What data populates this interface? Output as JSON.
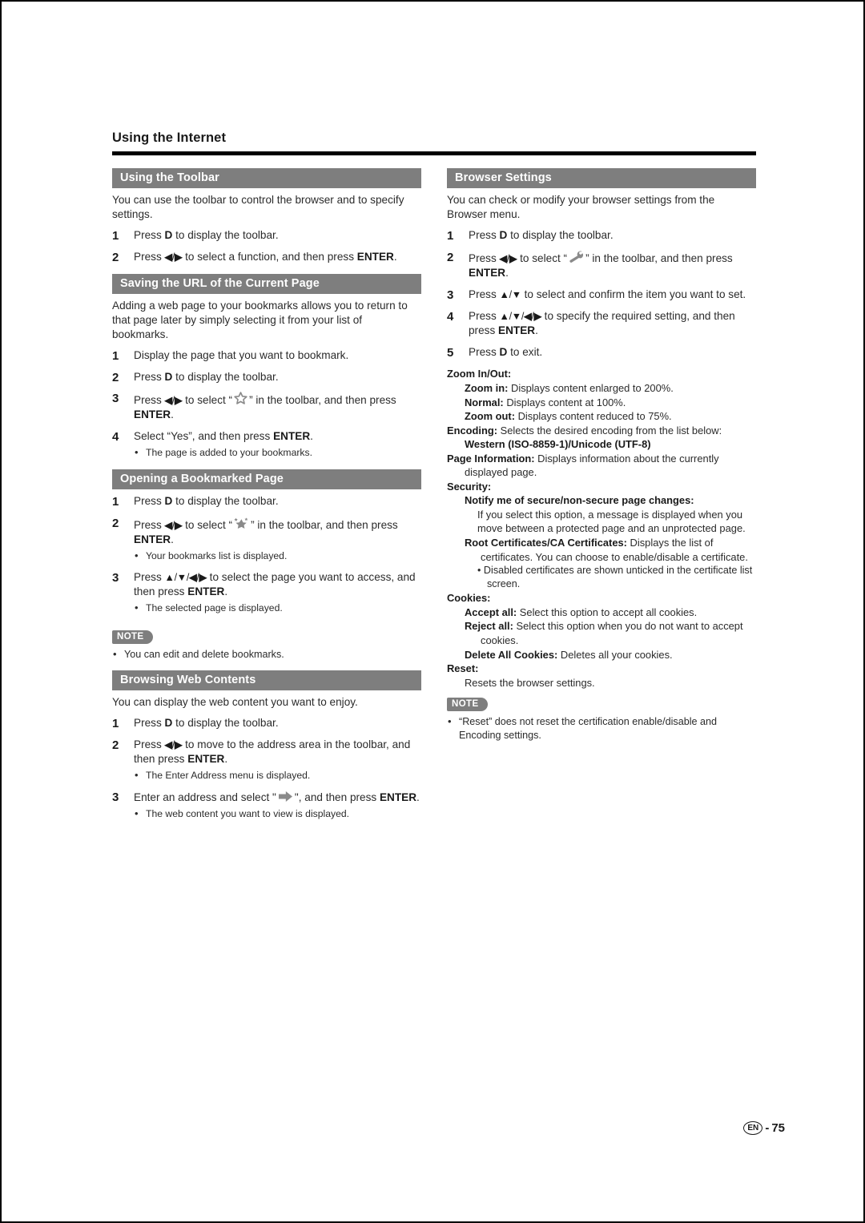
{
  "page": {
    "running_head": "Using the Internet",
    "footer_lang": "EN",
    "footer_sep": "-",
    "footer_page": "75"
  },
  "left_column": {
    "sections": [
      {
        "id": "using-the-toolbar",
        "heading": "Using the Toolbar",
        "intro": "You can use the toolbar to control the browser and to specify settings.",
        "steps": [
          {
            "num": "1",
            "text": "Press D to display the toolbar."
          },
          {
            "num": "2",
            "text": "Press ◀/▶ to select a function, and then press ENTER."
          }
        ]
      },
      {
        "id": "saving-the-url",
        "heading": "Saving the URL of the Current Page",
        "intro": "Adding a web page to your bookmarks allows you to return to that page later by simply selecting it from your list of bookmarks.",
        "steps": [
          {
            "num": "1",
            "text": "Display the page that you want to bookmark."
          },
          {
            "num": "2",
            "text": "Press D to display the toolbar."
          },
          {
            "num": "3",
            "text": "Press ◀/▶ to select “☆” in the toolbar, and then press ENTER."
          },
          {
            "num": "4",
            "text": "Select “Yes”, and then press ENTER.",
            "bullets": [
              "The page is added to your bookmarks."
            ]
          }
        ]
      },
      {
        "id": "opening-a-bookmarked-page",
        "heading": "Opening a Bookmarked Page",
        "steps": [
          {
            "num": "1",
            "text": "Press D to display the toolbar."
          },
          {
            "num": "2",
            "text": "Press ◀/▶ to select “★” in the toolbar, and then press ENTER.",
            "bullets": [
              "Your bookmarks list is displayed."
            ]
          },
          {
            "num": "3",
            "text": "Press ▲/▼/◀/▶ to select the page you want to access, and then press ENTER.",
            "bullets": [
              "The selected page is displayed."
            ]
          }
        ],
        "note": {
          "label": "NOTE",
          "items": [
            "You can edit and delete bookmarks."
          ]
        }
      },
      {
        "id": "browsing-web-contents",
        "heading": "Browsing Web Contents",
        "intro": "You can display the web content you want to enjoy.",
        "steps": [
          {
            "num": "1",
            "text": "Press D to display the toolbar."
          },
          {
            "num": "2",
            "text": "Press ◀/▶ to move to the address area in the toolbar, and then press ENTER.",
            "bullets": [
              "The Enter Address menu is displayed."
            ]
          },
          {
            "num": "3",
            "text": "Enter an address and select \"➡\", and then press ENTER.",
            "bullets": [
              "The web content you want to view is displayed."
            ]
          }
        ]
      }
    ]
  },
  "right_column": {
    "section": {
      "id": "browser-settings",
      "heading": "Browser Settings",
      "intro": "You can check or modify your browser settings from the Browser menu.",
      "steps": [
        {
          "num": "1",
          "text": "Press D to display the toolbar."
        },
        {
          "num": "2",
          "text": "Press ◀/▶ to select “🔧” in the toolbar, and then press ENTER."
        },
        {
          "num": "3",
          "text": "Press ▲/▼ to select and confirm the item you want to set."
        },
        {
          "num": "4",
          "text": "Press ▲/▼/◀/▶ to specify the required setting, and then press ENTER."
        },
        {
          "num": "5",
          "text": "Press D to exit."
        }
      ],
      "definitions": {
        "zoom_label": "Zoom In/Out:",
        "zoom_in_term": "Zoom in:",
        "zoom_in_desc": "Displays content enlarged to 200%.",
        "normal_term": "Normal:",
        "normal_desc": "Displays content at 100%.",
        "zoom_out_term": "Zoom out:",
        "zoom_out_desc": "Displays content reduced to 75%.",
        "encoding_term": "Encoding:",
        "encoding_desc": "Selects the desired encoding from the list below:",
        "encoding_value": "Western (ISO-8859-1)/Unicode (UTF-8)",
        "page_info_term": "Page Information:",
        "page_info_desc": "Displays information about the currently displayed page.",
        "security_label": "Security:",
        "notify_term": "Notify me of secure/non-secure page changes:",
        "notify_desc": "If you select this option, a message is displayed when you move between a protected page and an unprotected page.",
        "root_cert_term": "Root Certificates/CA Certificates:",
        "root_cert_desc": "Displays the list of certificates. You can choose to enable/disable a certificate.",
        "root_cert_bullet": "Disabled certificates are shown unticked in the certificate list screen.",
        "cookies_label": "Cookies:",
        "accept_all_term": "Accept all:",
        "accept_all_desc": "Select this option to accept all cookies.",
        "reject_all_term": "Reject all:",
        "reject_all_desc": "Select this option when you do not want to accept cookies.",
        "delete_cookies_term": "Delete All Cookies:",
        "delete_cookies_desc": "Deletes all your cookies.",
        "reset_label": "Reset:",
        "reset_desc": "Resets the browser settings."
      },
      "note": {
        "label": "NOTE",
        "items": [
          "“Reset” does not reset the certification enable/disable and Encoding settings."
        ]
      }
    }
  },
  "icons": {
    "star_outline": "star-outline-icon",
    "star_filled": "star-sparkle-icon",
    "wrench": "wrench-icon",
    "go_arrow": "go-arrow-icon"
  }
}
